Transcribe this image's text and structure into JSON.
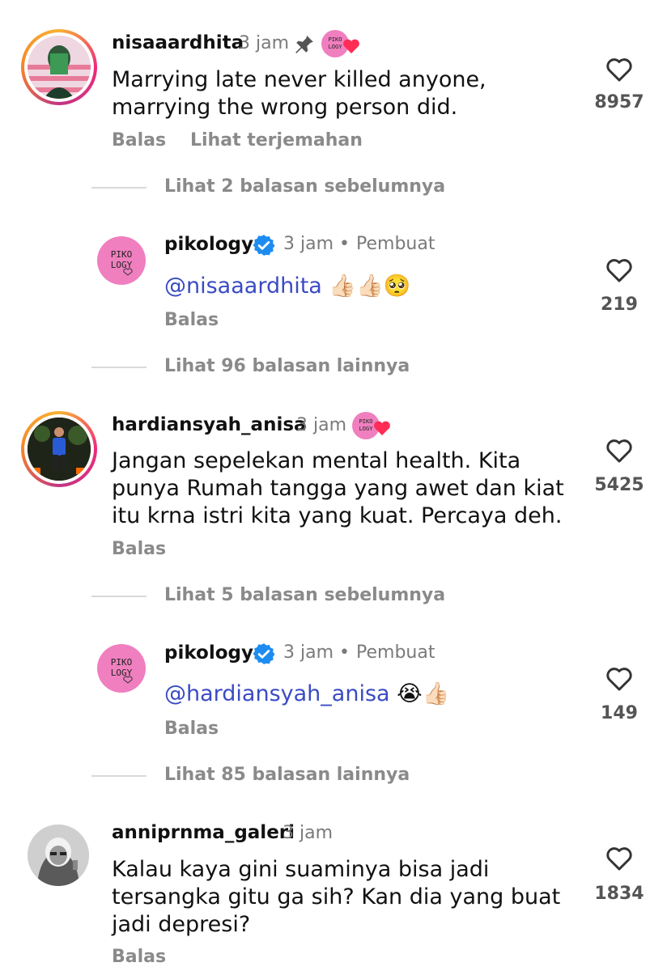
{
  "comments": [
    {
      "username": "nisaaardhita",
      "time": "3 jam",
      "text_line1": "Marrying late never killed anyone,",
      "text_line2": "marrying the wrong person did.",
      "likes": "8957",
      "reply_label": "Balas",
      "translate_label": "Lihat terjemahan"
    },
    {
      "username": "hardiansyah_anisa",
      "time": "3 jam",
      "text_line1": "Jangan sepelekan mental health. Kita",
      "text_line2": "punya Rumah tangga yang awet dan kiat",
      "text_line3": "itu krna istri kita yang kuat. Percaya deh.",
      "likes": "5425",
      "reply_label": "Balas"
    },
    {
      "username": "anniprnma_galeri",
      "time": "3 jam",
      "text_line1": "Kalau kaya gini suaminya bisa jadi",
      "text_line2": "tersangka gitu ga sih? Kan dia yang buat",
      "text_line3": "jadi depresi?",
      "likes": "1834",
      "reply_label": "Balas"
    }
  ],
  "replies": [
    {
      "username": "pikology",
      "time": "3 jam",
      "dot": "•",
      "creator_label": "Pembuat",
      "mention": "@nisaaardhita",
      "emojis": "👍🏻👍🏻🥺",
      "likes": "219",
      "reply_label": "Balas"
    },
    {
      "username": "pikology",
      "time": "3 jam",
      "dot": "•",
      "creator_label": "Pembuat",
      "mention": "@hardiansyah_anisa",
      "emojis": "😭👍🏻",
      "likes": "149",
      "reply_label": "Balas"
    }
  ],
  "threads": {
    "t1": "Lihat 2 balasan sebelumnya",
    "t2": "Lihat 96 balasan lainnya",
    "t3": "Lihat 5 balasan sebelumnya",
    "t4": "Lihat 85 balasan lainnya"
  },
  "logo_text": {
    "line1": "PIKO",
    "line2": "LOGY"
  },
  "colors": {
    "mention": "#3a4bc4",
    "verified": "#1d8cf0",
    "heart_badge": "#ff2d55",
    "pink_avatar": "#f07fbf"
  },
  "icons": {
    "heart": "heart-outline-icon",
    "pin": "pin-icon",
    "verified": "verified-badge-icon"
  }
}
